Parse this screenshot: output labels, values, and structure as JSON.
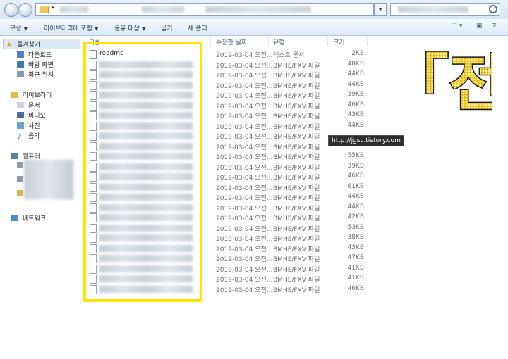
{
  "toolbar": {
    "organize": "구성",
    "include_library": "라이브러리에 포함",
    "share_with": "공유 대상",
    "burn": "굽기",
    "new_folder": "새 폴더"
  },
  "nav": {
    "favorites": "즐겨찾기",
    "downloads": "다운로드",
    "desktop": "바탕 화면",
    "recent": "최근 위치",
    "libraries": "라이브러리",
    "documents": "문서",
    "videos": "비디오",
    "pictures": "사진",
    "music": "음악",
    "computer": "컴퓨터",
    "network": "네트워크"
  },
  "columns": {
    "name": "이름",
    "date_modified": "수정한 날짜",
    "type": "유형",
    "size": "크기"
  },
  "files": [
    {
      "name": "readme",
      "date": "2019-03-04 오전...",
      "type": "텍스트 문서",
      "size": "2KB"
    },
    {
      "name": "",
      "date": "2019-03-04 오전...",
      "type": "BMHE/FXV 파일",
      "size": "48KB"
    },
    {
      "name": "",
      "date": "2019-03-04 오전...",
      "type": "BMHE/FXV 파일",
      "size": "44KB"
    },
    {
      "name": "",
      "date": "2019-03-04 오전...",
      "type": "BMHE/FXV 파일",
      "size": "44KB"
    },
    {
      "name": "",
      "date": "2019-03-04 오전...",
      "type": "BMHE/FXV 파일",
      "size": "39KB"
    },
    {
      "name": "",
      "date": "2019-03-04 오전...",
      "type": "BMHE/FXV 파일",
      "size": "46KB"
    },
    {
      "name": "",
      "date": "2019-03-04 오전...",
      "type": "BMHE/FXV 파일",
      "size": "43KB"
    },
    {
      "name": "",
      "date": "2019-03-04 오전...",
      "type": "BMHE/FXV 파일",
      "size": "44KB"
    },
    {
      "name": "",
      "date": "2019-03-04 오전...",
      "type": "BMHE/FXV 파일",
      "size": ""
    },
    {
      "name": "",
      "date": "2019-03-04 오전...",
      "type": "BMHE/FXV 파일",
      "size": ""
    },
    {
      "name": "",
      "date": "2019-03-04 오전...",
      "type": "BMHE/FXV 파일",
      "size": "55KB"
    },
    {
      "name": "",
      "date": "2019-03-04 오전...",
      "type": "BMHE/FXV 파일",
      "size": "39KB"
    },
    {
      "name": "",
      "date": "2019-03-04 오전...",
      "type": "BMHE/FXV 파일",
      "size": "46KB"
    },
    {
      "name": "",
      "date": "2019-03-04 오전...",
      "type": "BMHE/FXV 파일",
      "size": "61KB"
    },
    {
      "name": "",
      "date": "2019-03-04 오전...",
      "type": "BMHE/FXV 파일",
      "size": "44KB"
    },
    {
      "name": "",
      "date": "2019-03-04 오전...",
      "type": "BMHE/FXV 파일",
      "size": "44KB"
    },
    {
      "name": "",
      "date": "2019-03-04 오전...",
      "type": "BMHE/FXV 파일",
      "size": "42KB"
    },
    {
      "name": "",
      "date": "2019-03-04 오전...",
      "type": "BMHE/FXV 파일",
      "size": "53KB"
    },
    {
      "name": "",
      "date": "2019-03-04 오전...",
      "type": "BMHE/FXV 파일",
      "size": "38KB"
    },
    {
      "name": "",
      "date": "2019-03-04 오전...",
      "type": "BMHE/FXV 파일",
      "size": "43KB"
    },
    {
      "name": "",
      "date": "2019-03-04 오전...",
      "type": "BMHE/FXV 파일",
      "size": "47KB"
    },
    {
      "name": "",
      "date": "2019-03-04 오전...",
      "type": "BMHE/FXV 파일",
      "size": "41KB"
    },
    {
      "name": "",
      "date": "2019-03-04 오전...",
      "type": "BMHE/FXV 파일",
      "size": "41KB"
    },
    {
      "name": "",
      "date": "2019-03-04 오전...",
      "type": "BMHE/FXV 파일",
      "size": "46KB"
    }
  ],
  "watermark": "http://jgsc.tistory.com",
  "logo_text": "「전",
  "colors": {
    "highlight": "#ffe400",
    "logo_fill": "#f3d23a"
  }
}
